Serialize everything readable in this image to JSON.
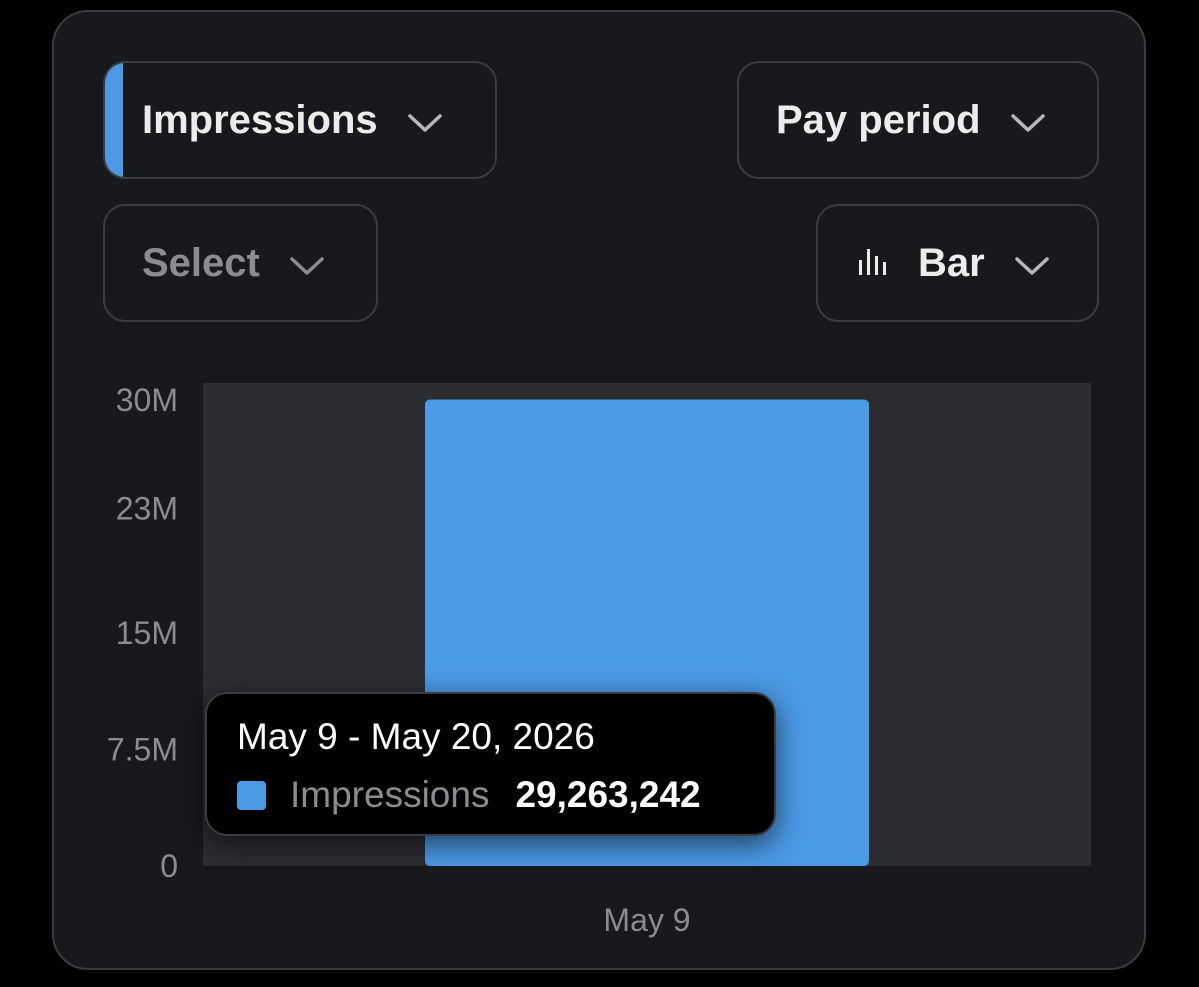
{
  "controls": {
    "metric": {
      "label": "Impressions",
      "accent_color": "#4b9ae6",
      "icon": "chevron-down-icon"
    },
    "period": {
      "label": "Pay period",
      "icon": "chevron-down-icon"
    },
    "compare": {
      "label": "Select",
      "icon": "chevron-down-icon"
    },
    "chart_type": {
      "label": "Bar",
      "icon": "bar-chart-icon"
    }
  },
  "tooltip": {
    "title": "May 9 - May 20, 2026",
    "series": "Impressions",
    "value": "29,263,242",
    "swatch_color": "#4b9ae6"
  },
  "chart_data": {
    "type": "bar",
    "categories": [
      "May 9"
    ],
    "series": [
      {
        "name": "Impressions",
        "values": [
          29263242
        ],
        "color": "#4b9ae6"
      }
    ],
    "ylim": [
      0,
      30000000
    ],
    "yticks": [
      {
        "value": 0,
        "label": "0"
      },
      {
        "value": 7500000,
        "label": "7.5M"
      },
      {
        "value": 15000000,
        "label": "15M"
      },
      {
        "value": 23000000,
        "label": "23M"
      },
      {
        "value": 30000000,
        "label": "30M"
      }
    ],
    "plot_background": "#2c2d31",
    "grid": false,
    "legend": "none"
  }
}
